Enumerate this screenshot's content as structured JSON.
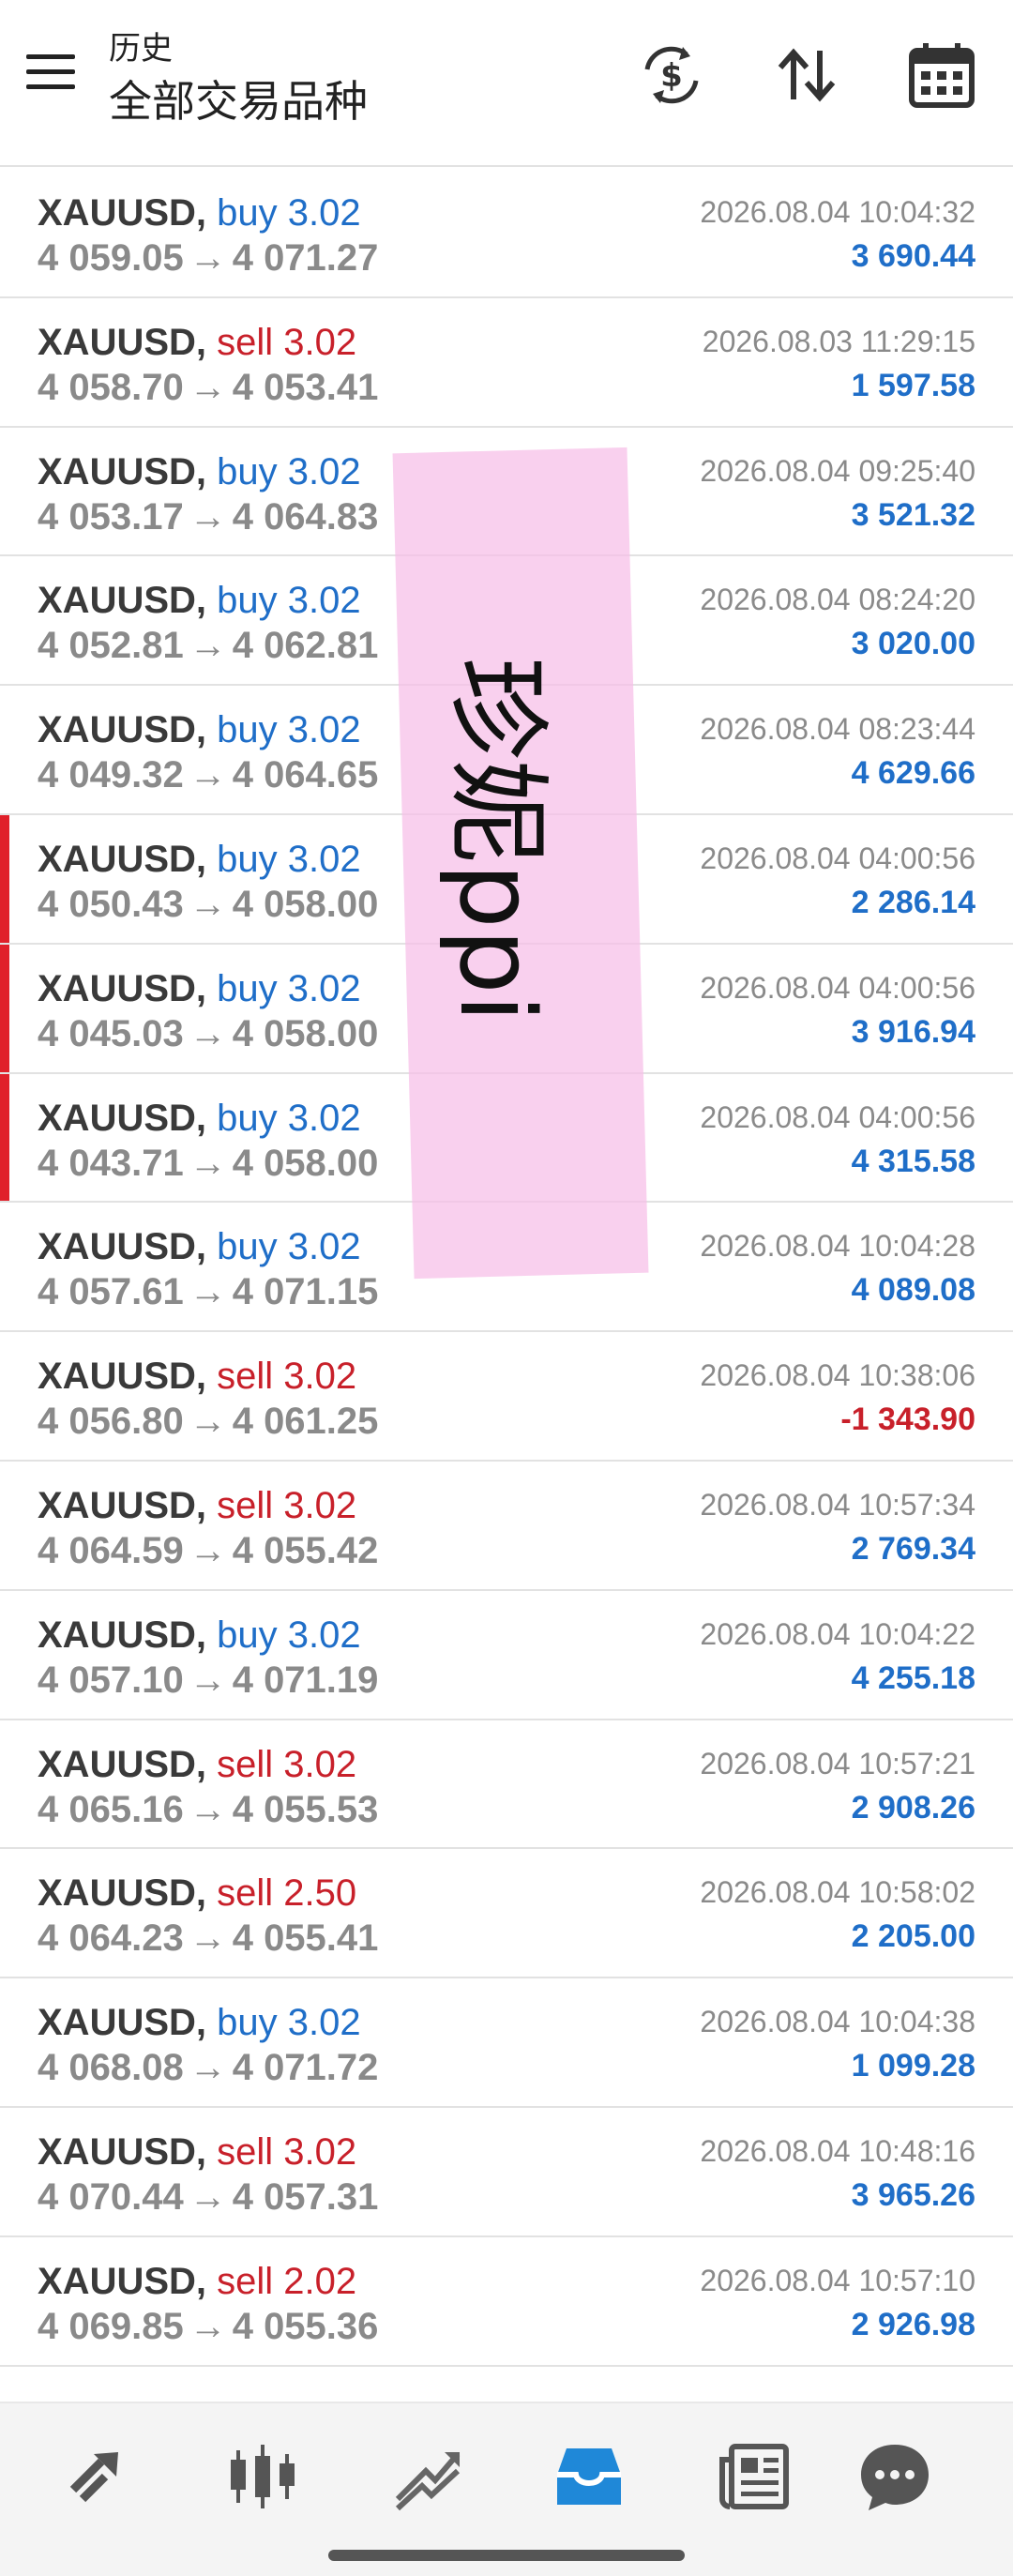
{
  "header": {
    "subtitle": "历史",
    "title": "全部交易品种",
    "icons": [
      "menu-icon",
      "currency-exchange-icon",
      "sort-icon",
      "calendar-icon"
    ]
  },
  "trades": [
    {
      "symbol": "XAUUSD",
      "side": "buy",
      "volume": "3.02",
      "open": "4 059.05",
      "close": "4 071.27",
      "time": "2026.08.04 10:04:32",
      "profit": "3 690.44",
      "negative": false,
      "marked": false
    },
    {
      "symbol": "XAUUSD",
      "side": "sell",
      "volume": "3.02",
      "open": "4 058.70",
      "close": "4 053.41",
      "time": "2026.08.03 11:29:15",
      "profit": "1 597.58",
      "negative": false,
      "marked": false
    },
    {
      "symbol": "XAUUSD",
      "side": "buy",
      "volume": "3.02",
      "open": "4 053.17",
      "close": "4 064.83",
      "time": "2026.08.04 09:25:40",
      "profit": "3 521.32",
      "negative": false,
      "marked": false
    },
    {
      "symbol": "XAUUSD",
      "side": "buy",
      "volume": "3.02",
      "open": "4 052.81",
      "close": "4 062.81",
      "time": "2026.08.04 08:24:20",
      "profit": "3 020.00",
      "negative": false,
      "marked": false
    },
    {
      "symbol": "XAUUSD",
      "side": "buy",
      "volume": "3.02",
      "open": "4 049.32",
      "close": "4 064.65",
      "time": "2026.08.04 08:23:44",
      "profit": "4 629.66",
      "negative": false,
      "marked": false
    },
    {
      "symbol": "XAUUSD",
      "side": "buy",
      "volume": "3.02",
      "open": "4 050.43",
      "close": "4 058.00",
      "time": "2026.08.04 04:00:56",
      "profit": "2 286.14",
      "negative": false,
      "marked": true
    },
    {
      "symbol": "XAUUSD",
      "side": "buy",
      "volume": "3.02",
      "open": "4 045.03",
      "close": "4 058.00",
      "time": "2026.08.04 04:00:56",
      "profit": "3 916.94",
      "negative": false,
      "marked": true
    },
    {
      "symbol": "XAUUSD",
      "side": "buy",
      "volume": "3.02",
      "open": "4 043.71",
      "close": "4 058.00",
      "time": "2026.08.04 04:00:56",
      "profit": "4 315.58",
      "negative": false,
      "marked": true
    },
    {
      "symbol": "XAUUSD",
      "side": "buy",
      "volume": "3.02",
      "open": "4 057.61",
      "close": "4 071.15",
      "time": "2026.08.04 10:04:28",
      "profit": "4 089.08",
      "negative": false,
      "marked": false
    },
    {
      "symbol": "XAUUSD",
      "side": "sell",
      "volume": "3.02",
      "open": "4 056.80",
      "close": "4 061.25",
      "time": "2026.08.04 10:38:06",
      "profit": "-1 343.90",
      "negative": true,
      "marked": false
    },
    {
      "symbol": "XAUUSD",
      "side": "sell",
      "volume": "3.02",
      "open": "4 064.59",
      "close": "4 055.42",
      "time": "2026.08.04 10:57:34",
      "profit": "2 769.34",
      "negative": false,
      "marked": false
    },
    {
      "symbol": "XAUUSD",
      "side": "buy",
      "volume": "3.02",
      "open": "4 057.10",
      "close": "4 071.19",
      "time": "2026.08.04 10:04:22",
      "profit": "4 255.18",
      "negative": false,
      "marked": false
    },
    {
      "symbol": "XAUUSD",
      "side": "sell",
      "volume": "3.02",
      "open": "4 065.16",
      "close": "4 055.53",
      "time": "2026.08.04 10:57:21",
      "profit": "2 908.26",
      "negative": false,
      "marked": false
    },
    {
      "symbol": "XAUUSD",
      "side": "sell",
      "volume": "2.50",
      "open": "4 064.23",
      "close": "4 055.41",
      "time": "2026.08.04 10:58:02",
      "profit": "2 205.00",
      "negative": false,
      "marked": false
    },
    {
      "symbol": "XAUUSD",
      "side": "buy",
      "volume": "3.02",
      "open": "4 068.08",
      "close": "4 071.72",
      "time": "2026.08.04 10:04:38",
      "profit": "1 099.28",
      "negative": false,
      "marked": false
    },
    {
      "symbol": "XAUUSD",
      "side": "sell",
      "volume": "3.02",
      "open": "4 070.44",
      "close": "4 057.31",
      "time": "2026.08.04 10:48:16",
      "profit": "3 965.26",
      "negative": false,
      "marked": false
    },
    {
      "symbol": "XAUUSD",
      "side": "sell",
      "volume": "2.02",
      "open": "4 069.85",
      "close": "4 055.36",
      "time": "2026.08.04 10:57:10",
      "profit": "2 926.98",
      "negative": false,
      "marked": false
    }
  ],
  "arrow": "→",
  "handwriting": "珍妮ppi",
  "colors": {
    "buy": "#1f6ec8",
    "sell": "#c8202a",
    "active_tab": "#1f88d8",
    "marker": "#e0202a",
    "tape": "#f6bee8"
  },
  "bottom_nav": [
    {
      "icon": "quotes-icon",
      "active": false
    },
    {
      "icon": "chart-icon",
      "active": false
    },
    {
      "icon": "trade-icon",
      "active": false
    },
    {
      "icon": "history-icon",
      "active": true
    },
    {
      "icon": "news-icon",
      "active": false
    },
    {
      "icon": "messages-icon",
      "active": false
    }
  ]
}
